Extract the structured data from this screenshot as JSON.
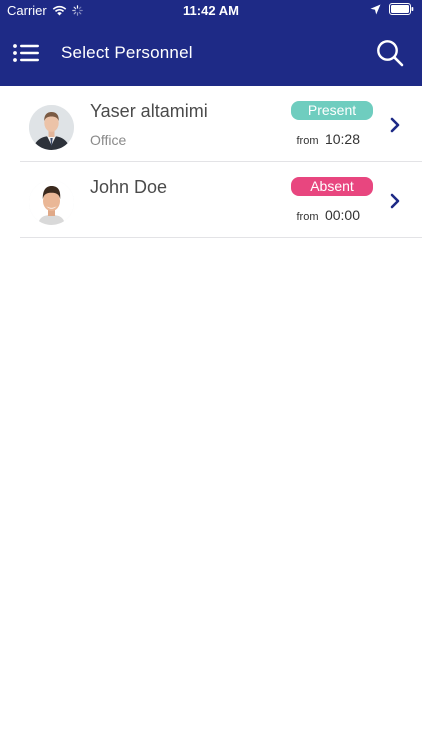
{
  "status_bar": {
    "carrier": "Carrier",
    "time": "11:42 AM",
    "icons": [
      "wifi-icon",
      "activity-spinner-icon",
      "location-arrow-icon",
      "battery-icon"
    ]
  },
  "nav": {
    "title": "Select Personnel",
    "menu_icon": "menu-list-icon",
    "search_icon": "search-icon",
    "background_color": "#1e2a86"
  },
  "personnel": [
    {
      "name": "Yaser altamimi",
      "location": "Office",
      "status": "Present",
      "status_color": "#6fcdbf",
      "from_label": "from",
      "from_time": "10:28"
    },
    {
      "name": "John Doe",
      "location": "",
      "status": "Absent",
      "status_color": "#e8467f",
      "from_label": "from",
      "from_time": "00:00"
    }
  ]
}
